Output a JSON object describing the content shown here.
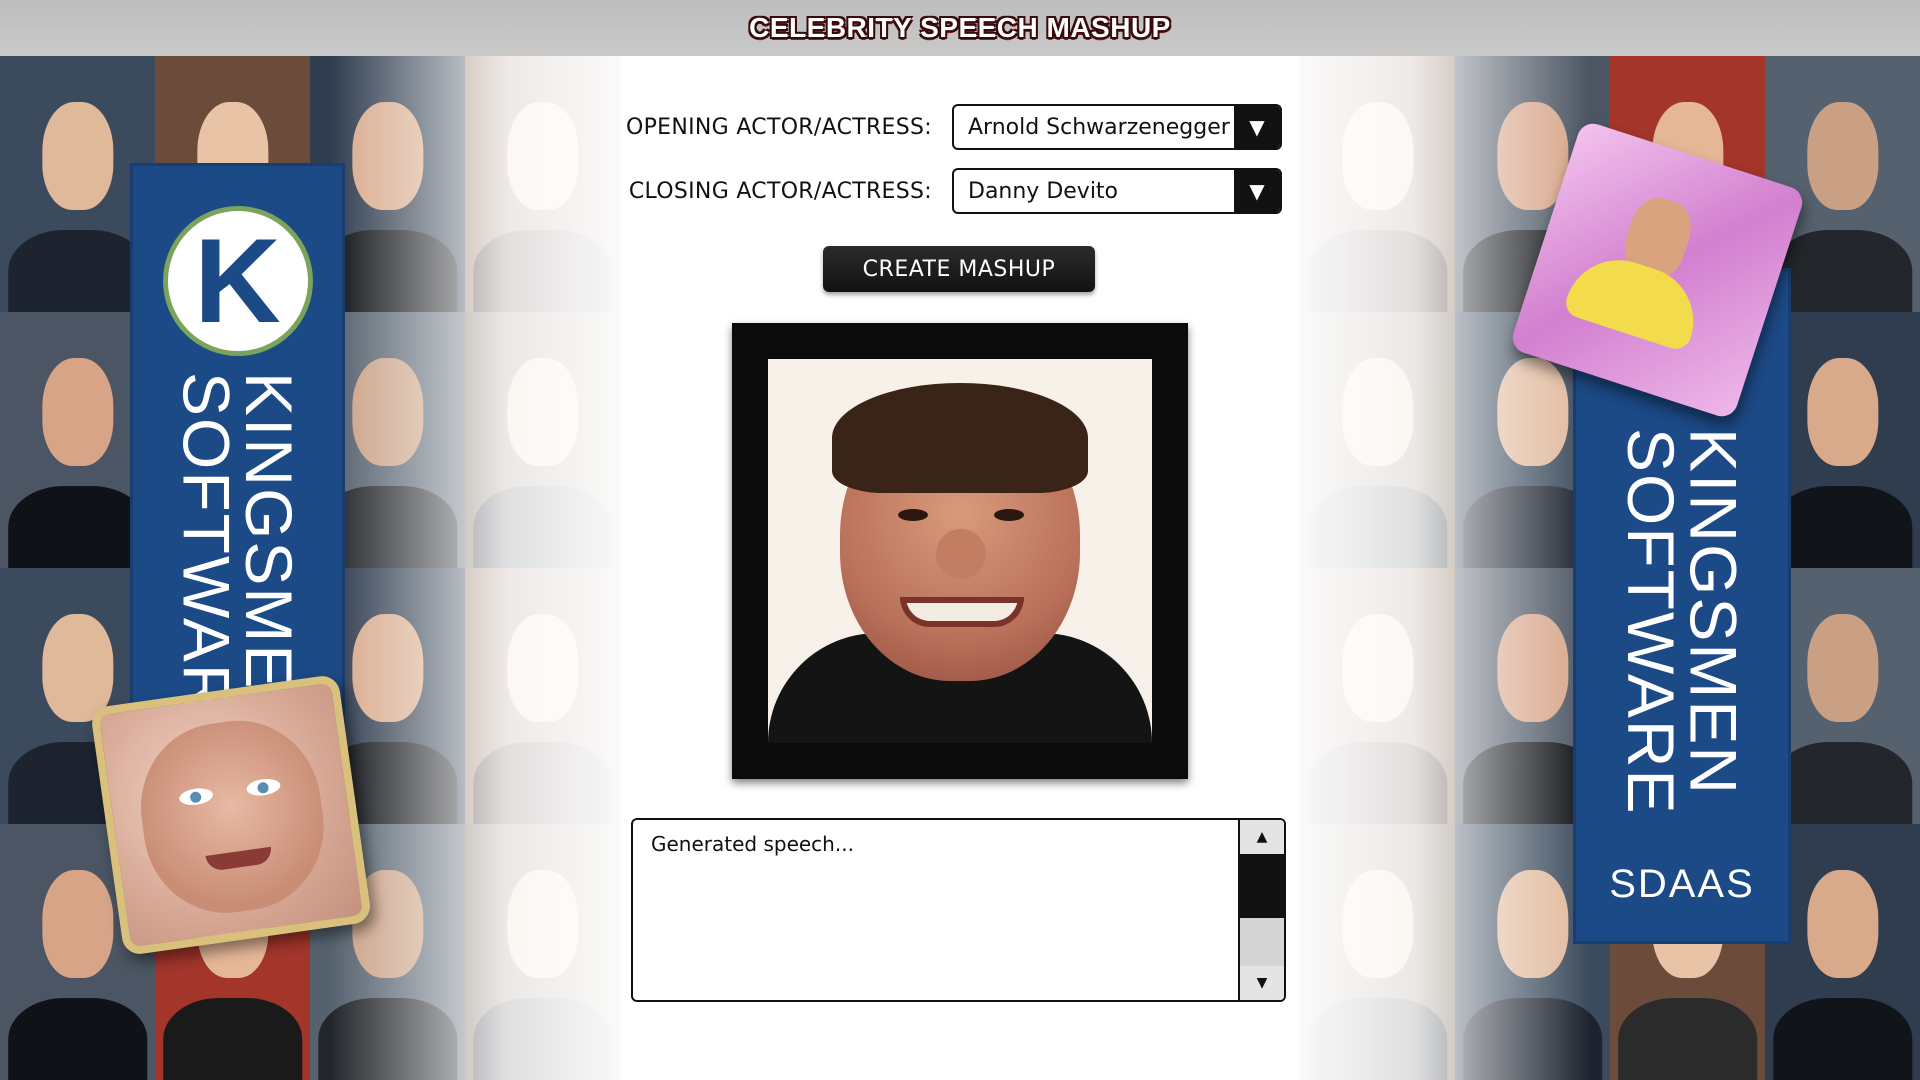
{
  "header": {
    "title": "CELEBRITY SPEECH MASHUP"
  },
  "form": {
    "opening_label": "OPENING ACTOR/ACTRESS:",
    "opening_value": "Arnold Schwarzenegger",
    "closing_label": "CLOSING ACTOR/ACTRESS:",
    "closing_value": "Danny Devito"
  },
  "actions": {
    "create_label": "CREATE MASHUP"
  },
  "speech": {
    "placeholder": "Generated speech..."
  },
  "banners": {
    "left_logo_letter": "K",
    "left_text_line1": "KINGSMEN",
    "left_text_line2": "SOFTWARE",
    "right_text_line1": "KINGSMEN",
    "right_text_line2": "SOFTWARE",
    "right_tagline": "SDAAS"
  },
  "icons": {
    "dropdown": "chevron-down-icon",
    "scroll_up": "arrow-up-icon",
    "scroll_down": "arrow-down-icon"
  },
  "colors": {
    "banner_blue": "#1c4a86",
    "logo_green": "#7aa35c",
    "title_outline": "#3a0a0a",
    "button_dark": "#111111"
  }
}
